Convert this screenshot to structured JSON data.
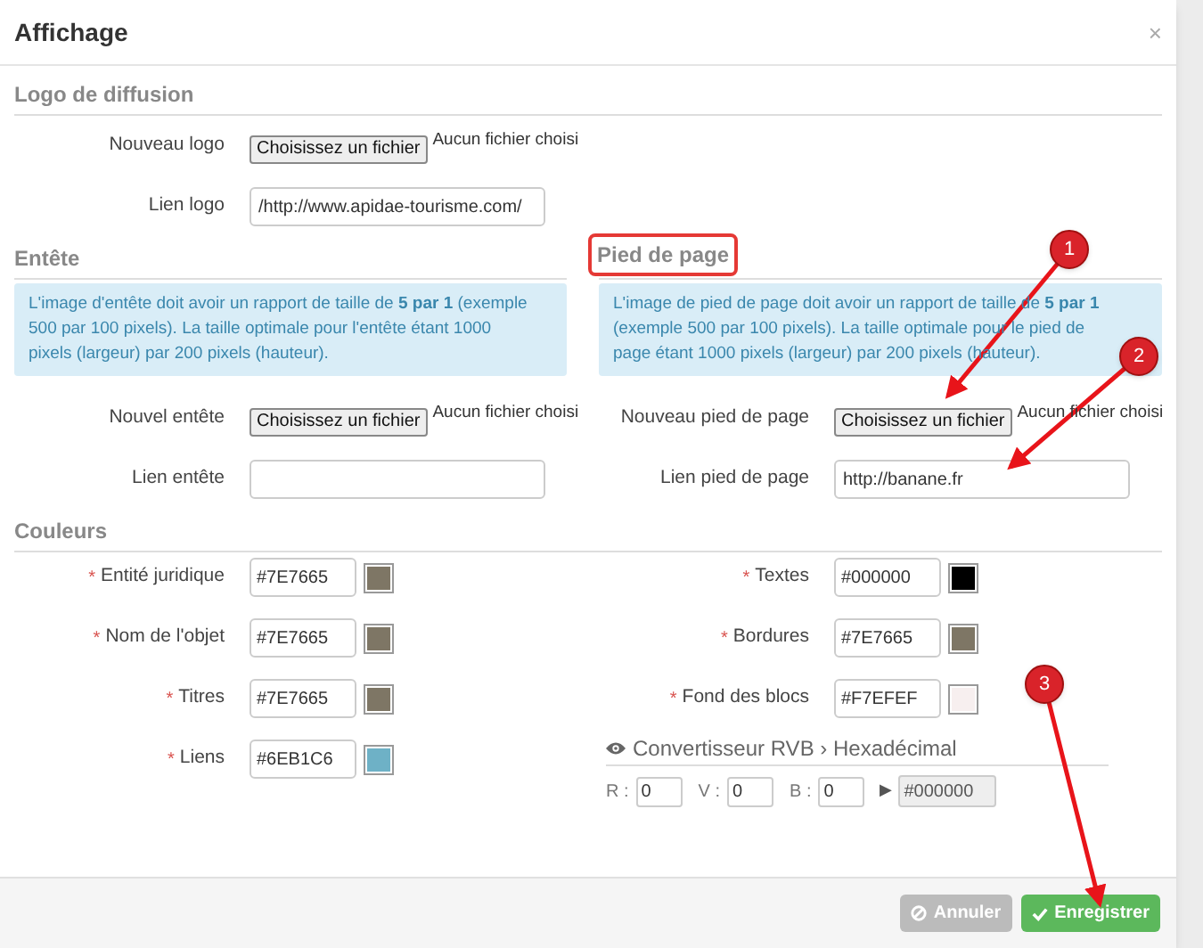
{
  "window": {
    "title": "Affichage",
    "close": "×"
  },
  "logo_section": {
    "heading": "Logo de diffusion",
    "fields": [
      {
        "kind": "file",
        "label": "Nouveau logo",
        "button": "Choisissez un fichier",
        "status": "Aucun fichier choisi"
      },
      {
        "kind": "text",
        "label": "Lien logo",
        "value": "/http://www.apidae-tourisme.com/"
      }
    ]
  },
  "columns": [
    {
      "heading": "Entête",
      "highlighted": false,
      "info": "L'image d'entête doit avoir un rapport de taille de **5 par 1** (exemple 500 par 100 pixels). La taille optimale pour l'entête étant 1000 pixels (largeur) par 200 pixels (hauteur).",
      "fields": [
        {
          "kind": "file",
          "label": "Nouvel entête",
          "button": "Choisissez un fichier",
          "status": "Aucun fichier choisi"
        },
        {
          "kind": "text",
          "label": "Lien entête"
        }
      ]
    },
    {
      "heading": "Pied de page",
      "highlighted": true,
      "info": "L'image de pied de page doit avoir un rapport de taille de **5 par 1** (exemple 500 par 100 pixels). La taille optimale pour le pied de page étant 1000 pixels (largeur) par 200 pixels (hauteur).",
      "fields": [
        {
          "kind": "file",
          "label": "Nouveau pied de page",
          "button": "Choisissez un fichier",
          "status": "Aucun fichier choisi"
        },
        {
          "kind": "text",
          "label": "Lien pied de page",
          "value": "http://banane.fr"
        }
      ]
    }
  ],
  "colors": {
    "heading": "Couleurs",
    "left": [
      {
        "required_mark": "*",
        "label": "Entité juridique",
        "value": "#7E7665",
        "color": "#7e7665"
      },
      {
        "required_mark": "*",
        "label": "Nom de l'objet",
        "value": "#7E7665",
        "color": "#7e7665"
      },
      {
        "required_mark": "*",
        "label": "Titres",
        "value": "#7E7665",
        "color": "#7e7665"
      },
      {
        "required_mark": "*",
        "label": "Liens",
        "value": "#6EB1C6",
        "color": "#6eb1c6"
      }
    ],
    "right": [
      {
        "required_mark": "*",
        "label": "Textes",
        "value": "#000000",
        "color": "#000000"
      },
      {
        "required_mark": "*",
        "label": "Bordures",
        "value": "#7E7665",
        "color": "#7e7665"
      },
      {
        "required_mark": "*",
        "label": "Fond des blocs",
        "value": "#F7EFEF",
        "color": "#f7efef"
      }
    ]
  },
  "converter": {
    "title": "Convertisseur RVB › Hexadécimal",
    "fields": [
      {
        "label": "R :",
        "value": "0"
      },
      {
        "label": "V :",
        "value": "0"
      },
      {
        "label": "B :",
        "value": "0"
      }
    ],
    "arrow": "▶",
    "result": "#000000"
  },
  "buttons": [
    {
      "kind": "cancel",
      "label": "Annuler",
      "disabled": true
    },
    {
      "kind": "save",
      "label": "Enregistrer",
      "disabled": false
    }
  ],
  "annotations": [
    {
      "number": "1"
    },
    {
      "number": "2"
    },
    {
      "number": "3"
    }
  ]
}
